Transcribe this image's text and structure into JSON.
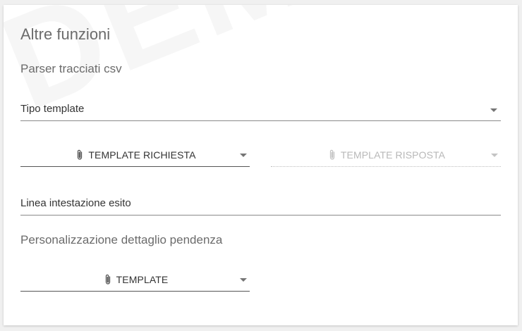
{
  "card": {
    "title": "Altre funzioni",
    "csv_section": {
      "heading": "Parser tracciati csv",
      "template_type": {
        "label": "Tipo template"
      },
      "request_template": {
        "label": "TEMPLATE RICHIESTA",
        "icon": "paperclip-icon",
        "enabled": true
      },
      "response_template": {
        "label": "TEMPLATE RISPOSTA",
        "icon": "paperclip-icon",
        "enabled": false
      },
      "header_line": {
        "label": "Linea intestazione esito"
      }
    },
    "detail_section": {
      "heading": "Personalizzazione dettaglio pendenza",
      "template": {
        "label": "TEMPLATE",
        "icon": "paperclip-icon",
        "enabled": true
      }
    }
  },
  "colors": {
    "heading": "#6b6b6b",
    "underline": "#8a8a8a",
    "disabled_text": "#b8b8b8"
  }
}
